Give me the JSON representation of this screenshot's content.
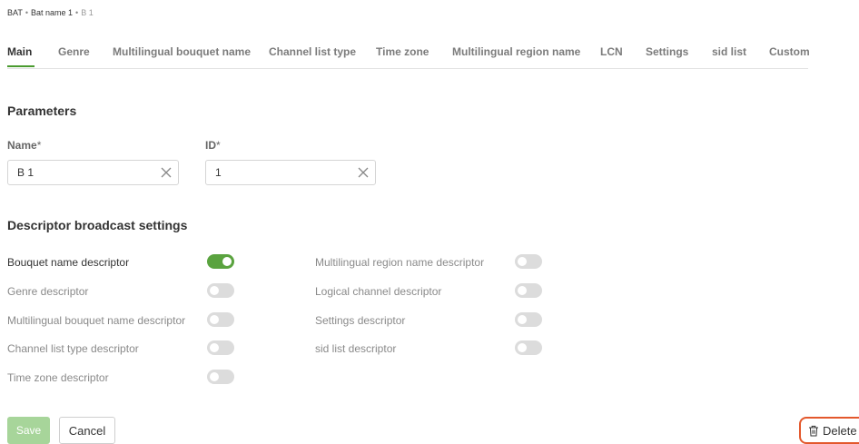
{
  "breadcrumb": {
    "root": "BAT",
    "parent": "Bat name 1",
    "current": "B 1",
    "separator": "•"
  },
  "tabs": [
    {
      "label": "Main",
      "active": true
    },
    {
      "label": "Genre"
    },
    {
      "label": "Multilingual bouquet name"
    },
    {
      "label": "Channel list type"
    },
    {
      "label": "Time zone"
    },
    {
      "label": "Multilingual region name"
    },
    {
      "label": "LCN"
    },
    {
      "label": "Settings"
    },
    {
      "label": "sid list"
    },
    {
      "label": "Custom"
    }
  ],
  "parameters": {
    "heading": "Parameters",
    "name": {
      "label": "Name",
      "required_mark": "*",
      "value": "B 1"
    },
    "id": {
      "label": "ID",
      "required_mark": "*",
      "value": "1"
    }
  },
  "descriptors": {
    "heading": "Descriptor broadcast settings",
    "left": [
      {
        "label": "Bouquet name descriptor",
        "enabled": true
      },
      {
        "label": "Genre descriptor",
        "enabled": false
      },
      {
        "label": "Multilingual bouquet name descriptor",
        "enabled": false
      },
      {
        "label": "Channel list type descriptor",
        "enabled": false
      },
      {
        "label": "Time zone descriptor",
        "enabled": false
      }
    ],
    "right": [
      {
        "label": "Multilingual region name descriptor",
        "enabled": false
      },
      {
        "label": "Logical channel descriptor",
        "enabled": false
      },
      {
        "label": "Settings descriptor",
        "enabled": false
      },
      {
        "label": "sid list descriptor",
        "enabled": false
      }
    ]
  },
  "actions": {
    "save": "Save",
    "cancel": "Cancel",
    "delete": "Delete"
  },
  "colors": {
    "accent": "#5aa33f",
    "save_disabled": "#a7d59a",
    "delete_border": "#e3582c",
    "toggle_off": "#dcdcdc"
  },
  "icons": {
    "clear": "close-icon",
    "delete": "trash-icon"
  }
}
